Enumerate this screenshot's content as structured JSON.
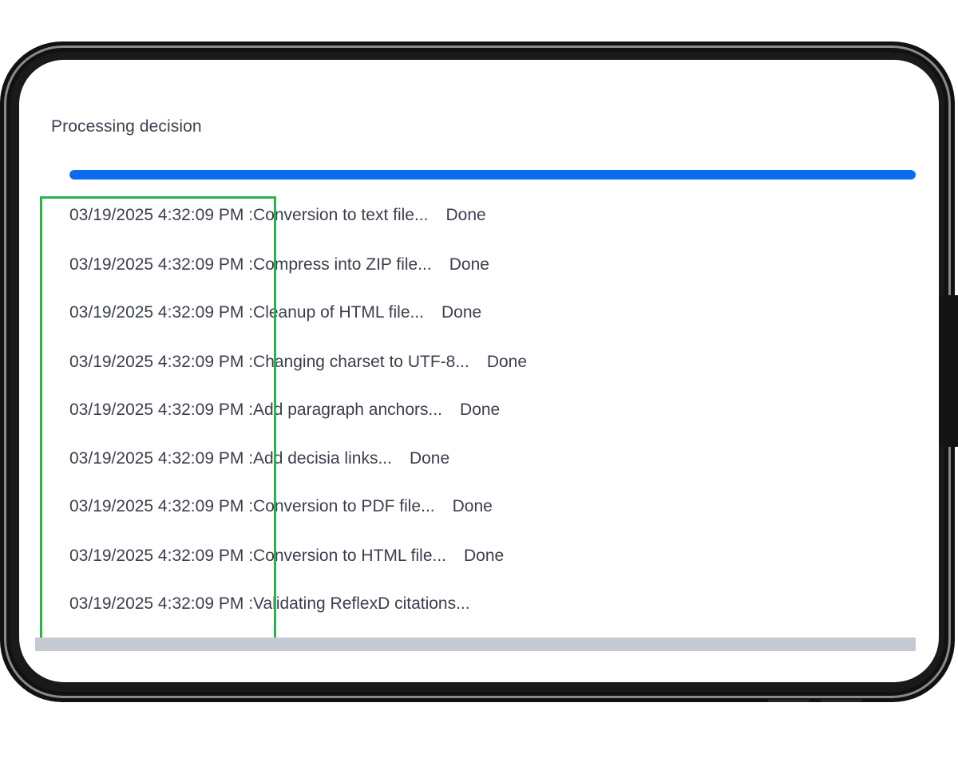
{
  "header": {
    "title": "Processing decision"
  },
  "progress": {
    "percent": 100,
    "color": "#0b6bef"
  },
  "highlight": {
    "color": "#2db24a"
  },
  "log": [
    {
      "timestamp": "03/19/2025 4:32:09 PM",
      "separator": ":",
      "message": "Conversion to text file...",
      "status": "Done"
    },
    {
      "timestamp": "03/19/2025 4:32:09 PM",
      "separator": ":",
      "message": "Compress into ZIP file...",
      "status": "Done"
    },
    {
      "timestamp": "03/19/2025 4:32:09 PM",
      "separator": ":",
      "message": "Cleanup of HTML file...",
      "status": "Done"
    },
    {
      "timestamp": "03/19/2025 4:32:09 PM",
      "separator": ":",
      "message": "Changing charset to UTF-8...",
      "status": "Done"
    },
    {
      "timestamp": "03/19/2025 4:32:09 PM",
      "separator": ":",
      "message": "Add paragraph anchors...",
      "status": "Done"
    },
    {
      "timestamp": "03/19/2025 4:32:09 PM",
      "separator": ":",
      "message": "Add decisia links...",
      "status": "Done"
    },
    {
      "timestamp": "03/19/2025 4:32:09 PM",
      "separator": ":",
      "message": "Conversion to PDF file...",
      "status": "Done"
    },
    {
      "timestamp": "03/19/2025 4:32:09 PM",
      "separator": ":",
      "message": "Conversion to HTML file...",
      "status": "Done"
    },
    {
      "timestamp": "03/19/2025 4:32:09 PM",
      "separator": ":",
      "message": "Validating ReflexD citations...",
      "status": ""
    }
  ]
}
